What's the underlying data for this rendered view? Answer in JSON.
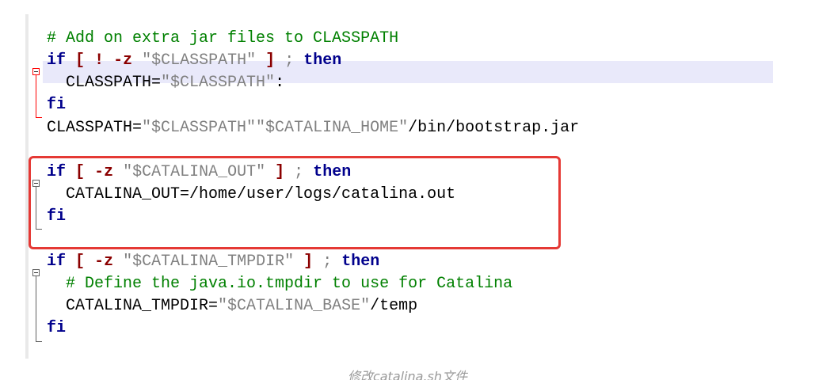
{
  "code_lines": [
    {
      "segments": [
        {
          "t": "# Add on extra jar files to CLASSPATH",
          "c": "comment"
        }
      ]
    },
    {
      "segments": [
        {
          "t": "if",
          "c": "kw"
        },
        {
          "t": " ",
          "c": "plain"
        },
        {
          "t": "[",
          "c": "op"
        },
        {
          "t": " ",
          "c": "plain"
        },
        {
          "t": "!",
          "c": "op"
        },
        {
          "t": " ",
          "c": "plain"
        },
        {
          "t": "-z",
          "c": "op"
        },
        {
          "t": " ",
          "c": "plain"
        },
        {
          "t": "\"$CLASSPATH\"",
          "c": "str"
        },
        {
          "t": " ",
          "c": "plain"
        },
        {
          "t": "]",
          "c": "op"
        },
        {
          "t": " ",
          "c": "plain"
        },
        {
          "t": ";",
          "c": "str"
        },
        {
          "t": " ",
          "c": "plain"
        },
        {
          "t": "then",
          "c": "kw"
        }
      ]
    },
    {
      "segments": [
        {
          "t": "  CLASSPATH=",
          "c": "plain"
        },
        {
          "t": "\"$CLASSPATH\"",
          "c": "str"
        },
        {
          "t": ":",
          "c": "plain"
        }
      ]
    },
    {
      "segments": [
        {
          "t": "fi",
          "c": "kw"
        }
      ]
    },
    {
      "segments": [
        {
          "t": "CLASSPATH=",
          "c": "plain"
        },
        {
          "t": "\"$CLASSPATH\"\"$CATALINA_HOME\"",
          "c": "str"
        },
        {
          "t": "/bin/bootstrap.jar",
          "c": "plain"
        }
      ]
    },
    {
      "segments": []
    },
    {
      "segments": [
        {
          "t": "if",
          "c": "kw"
        },
        {
          "t": " ",
          "c": "plain"
        },
        {
          "t": "[",
          "c": "op"
        },
        {
          "t": " ",
          "c": "plain"
        },
        {
          "t": "-z",
          "c": "op"
        },
        {
          "t": " ",
          "c": "plain"
        },
        {
          "t": "\"$CATALINA_OUT\"",
          "c": "str"
        },
        {
          "t": " ",
          "c": "plain"
        },
        {
          "t": "]",
          "c": "op"
        },
        {
          "t": " ",
          "c": "plain"
        },
        {
          "t": ";",
          "c": "str"
        },
        {
          "t": " ",
          "c": "plain"
        },
        {
          "t": "then",
          "c": "kw"
        }
      ]
    },
    {
      "segments": [
        {
          "t": "  CATALINA_OUT=/home/user/logs/catalina.out",
          "c": "plain"
        }
      ]
    },
    {
      "segments": [
        {
          "t": "fi",
          "c": "kw"
        }
      ]
    },
    {
      "segments": []
    },
    {
      "segments": [
        {
          "t": "if",
          "c": "kw"
        },
        {
          "t": " ",
          "c": "plain"
        },
        {
          "t": "[",
          "c": "op"
        },
        {
          "t": " ",
          "c": "plain"
        },
        {
          "t": "-z",
          "c": "op"
        },
        {
          "t": " ",
          "c": "plain"
        },
        {
          "t": "\"$CATALINA_TMPDIR\"",
          "c": "str"
        },
        {
          "t": " ",
          "c": "plain"
        },
        {
          "t": "]",
          "c": "op"
        },
        {
          "t": " ",
          "c": "plain"
        },
        {
          "t": ";",
          "c": "str"
        },
        {
          "t": " ",
          "c": "plain"
        },
        {
          "t": "then",
          "c": "kw"
        }
      ]
    },
    {
      "segments": [
        {
          "t": "  # Define the java.io.tmpdir to use for Catalina",
          "c": "comment"
        }
      ]
    },
    {
      "segments": [
        {
          "t": "  CATALINA_TMPDIR=",
          "c": "plain"
        },
        {
          "t": "\"$CATALINA_BASE\"",
          "c": "str"
        },
        {
          "t": "/temp",
          "c": "plain"
        }
      ]
    },
    {
      "segments": [
        {
          "t": "fi",
          "c": "kw"
        }
      ]
    }
  ],
  "caption": "修改catalina.sh文件",
  "colors": {
    "comment": "#008000",
    "keyword": "#00008c",
    "operator": "#8b0000",
    "string": "#808080",
    "current_line": "#e9e9fa",
    "highlight_box": "#e53935"
  }
}
